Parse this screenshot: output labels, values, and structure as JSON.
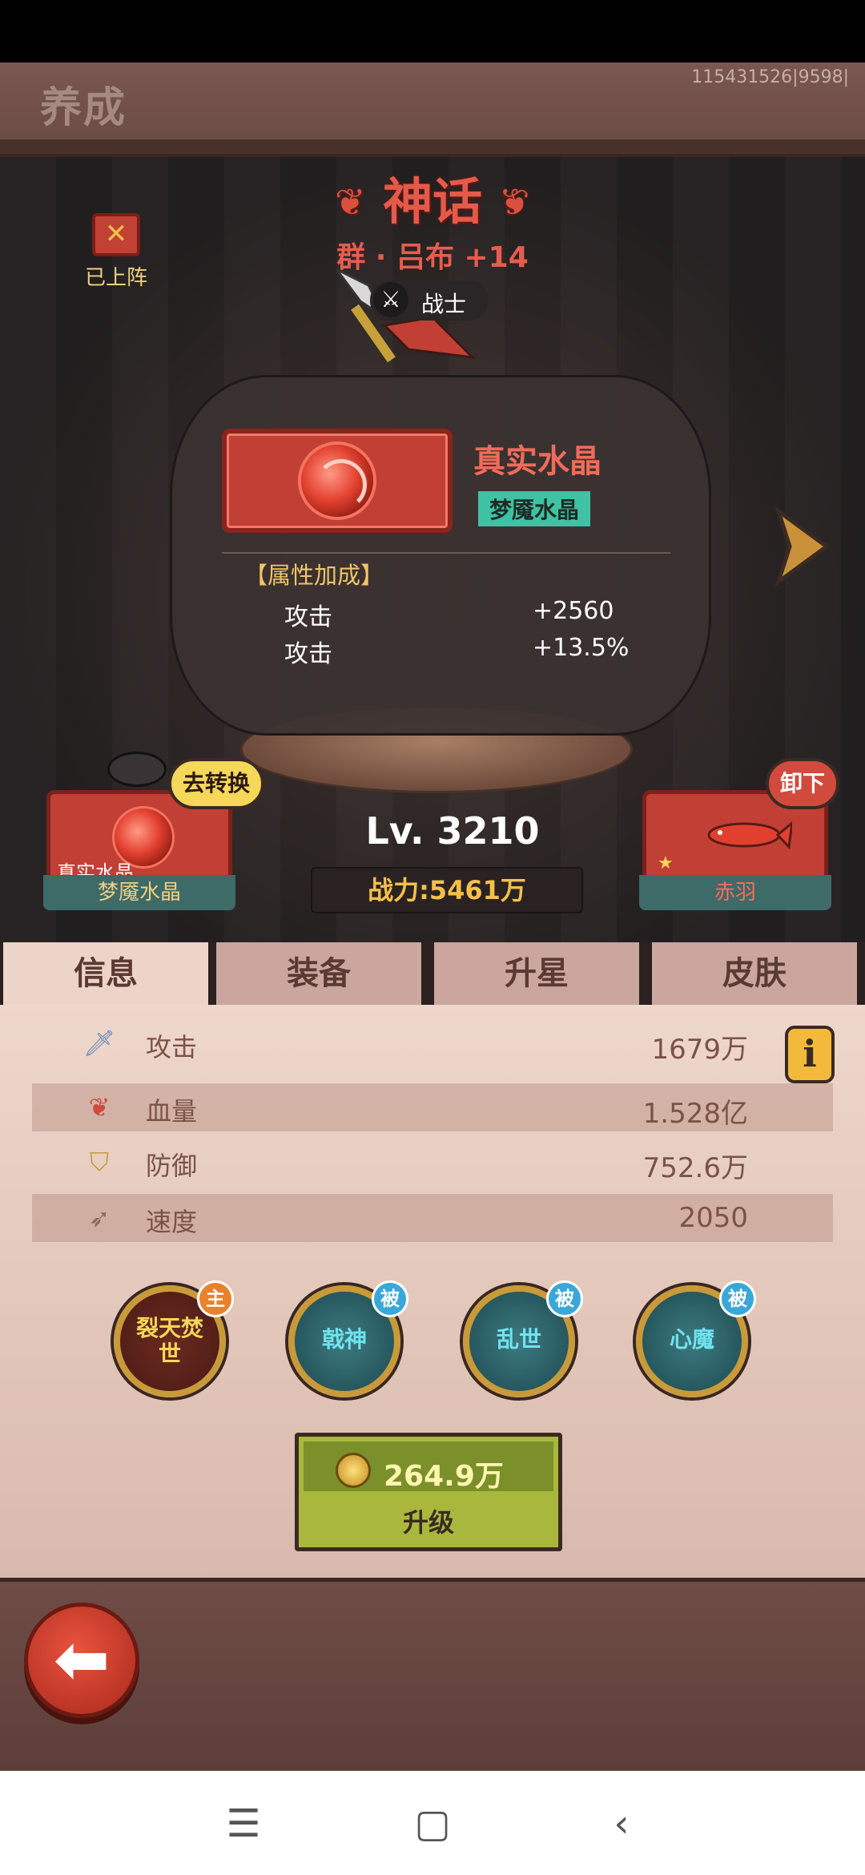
{
  "header": {
    "title": "养成",
    "server_id": "115431526|9598|"
  },
  "hero": {
    "deployed_label": "已上阵",
    "rarity": "神话",
    "name": "群 · 吕布 +14",
    "class_label": "战士",
    "level": "Lv. 3210",
    "power": "战力:5461万"
  },
  "popup": {
    "title": "真实水晶",
    "subtitle": "梦魇水晶",
    "attr_title": "【属性加成】",
    "attrs": [
      {
        "name": "攻击",
        "value": "+2560"
      },
      {
        "name": "攻击",
        "value": "+13.5%"
      }
    ]
  },
  "left_slot": {
    "bubble": "去转换",
    "name": "真实水晶",
    "caption": "梦魇水晶"
  },
  "right_slot": {
    "bubble": "卸下",
    "caption": "赤羽"
  },
  "tabs": [
    "信息",
    "装备",
    "升星",
    "皮肤"
  ],
  "stats": [
    {
      "name": "攻击",
      "value": "1679万",
      "icon": "sword-icon"
    },
    {
      "name": "血量",
      "value": "1.528亿",
      "icon": "blood-drop-icon"
    },
    {
      "name": "防御",
      "value": "752.6万",
      "icon": "shield-icon"
    },
    {
      "name": "速度",
      "value": "2050",
      "icon": "boot-icon"
    }
  ],
  "info_button": "i",
  "skills": [
    {
      "name": "裂天焚世",
      "badge": "主"
    },
    {
      "name": "戟神",
      "badge": "被"
    },
    {
      "name": "乱世",
      "badge": "被"
    },
    {
      "name": "心魔",
      "badge": "被"
    }
  ],
  "upgrade": {
    "cost": "264.9万",
    "label": "升级"
  },
  "colors": {
    "accent_red": "#c23f35",
    "gold": "#f5c04a",
    "teal": "#3fc2a3"
  }
}
